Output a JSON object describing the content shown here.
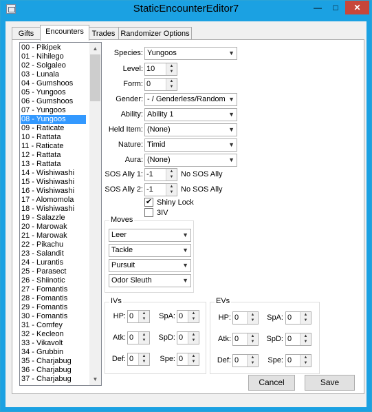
{
  "window": {
    "title": "StaticEncounterEditor7"
  },
  "tabs": [
    {
      "label": "Gifts"
    },
    {
      "label": "Encounters"
    },
    {
      "label": "Trades"
    },
    {
      "label": "Randomizer Options"
    }
  ],
  "encounter_list": {
    "selected_index": 8,
    "items": [
      "00 - Pikipek",
      "01 - Nihilego",
      "02 - Solgaleo",
      "03 - Lunala",
      "04 - Gumshoos",
      "05 - Yungoos",
      "06 - Gumshoos",
      "07 - Yungoos",
      "08 - Yungoos",
      "09 - Raticate",
      "10 - Rattata",
      "11 - Raticate",
      "12 - Rattata",
      "13 - Rattata",
      "14 - Wishiwashi",
      "15 - Wishiwashi",
      "16 - Wishiwashi",
      "17 - Alomomola",
      "18 - Wishiwashi",
      "19 - Salazzle",
      "20 - Marowak",
      "21 - Marowak",
      "22 - Pikachu",
      "23 - Salandit",
      "24 - Lurantis",
      "25 - Parasect",
      "26 - Shiinotic",
      "27 - Fomantis",
      "28 - Fomantis",
      "29 - Fomantis",
      "30 - Fomantis",
      "31 - Comfey",
      "32 - Kecleon",
      "33 - Vikavolt",
      "34 - Grubbin",
      "35 - Charjabug",
      "36 - Charjabug",
      "37 - Charjabug"
    ]
  },
  "fields": {
    "species": {
      "label": "Species:",
      "value": "Yungoos"
    },
    "level": {
      "label": "Level:",
      "value": "10"
    },
    "form": {
      "label": "Form:",
      "value": "0"
    },
    "gender": {
      "label": "Gender:",
      "value": "- / Genderless/Random"
    },
    "ability": {
      "label": "Ability:",
      "value": "Ability 1"
    },
    "held_item": {
      "label": "Held Item:",
      "value": "(None)"
    },
    "nature": {
      "label": "Nature:",
      "value": "Timid"
    },
    "aura": {
      "label": "Aura:",
      "value": "(None)"
    },
    "sos_ally_1": {
      "label": "SOS Ally 1:",
      "value": "-1",
      "note": "No SOS Ally"
    },
    "sos_ally_2": {
      "label": "SOS Ally 2:",
      "value": "-1",
      "note": "No SOS Ally"
    },
    "shiny_lock": {
      "label": "Shiny Lock",
      "checked": true
    },
    "three_iv": {
      "label": "3IV",
      "checked": false
    }
  },
  "moves": {
    "title": "Moves",
    "items": [
      "Leer",
      "Tackle",
      "Pursuit",
      "Odor Sleuth"
    ]
  },
  "ivs": {
    "title": "IVs",
    "hp": {
      "label": "HP:",
      "value": "0"
    },
    "atk": {
      "label": "Atk:",
      "value": "0"
    },
    "def": {
      "label": "Def:",
      "value": "0"
    },
    "spa": {
      "label": "SpA:",
      "value": "0"
    },
    "spd": {
      "label": "SpD:",
      "value": "0"
    },
    "spe": {
      "label": "Spe:",
      "value": "0"
    }
  },
  "evs": {
    "title": "EVs",
    "hp": {
      "label": "HP:",
      "value": "0"
    },
    "atk": {
      "label": "Atk:",
      "value": "0"
    },
    "def": {
      "label": "Def:",
      "value": "0"
    },
    "spa": {
      "label": "SpA:",
      "value": "0"
    },
    "spd": {
      "label": "SpD:",
      "value": "0"
    },
    "spe": {
      "label": "Spe:",
      "value": "0"
    }
  },
  "buttons": {
    "cancel": "Cancel",
    "save": "Save"
  },
  "titlebar_buttons": {
    "minimize": "—",
    "maximize": "□",
    "close": "✕"
  },
  "colors": {
    "titlebar": "#1ba1e2",
    "selection": "#3399ff",
    "close": "#c7463a"
  }
}
